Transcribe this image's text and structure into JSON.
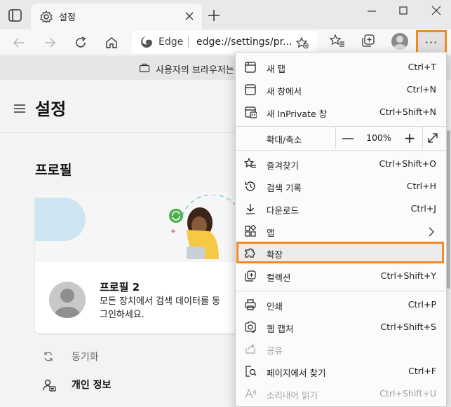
{
  "window": {
    "tab_title": "설정"
  },
  "toolbar": {
    "address_brand": "Edge",
    "address_url": "edge://settings/pr..."
  },
  "infobar": {
    "text": "사용자의 브라우저는"
  },
  "settings": {
    "title": "설정",
    "section_title": "프로필",
    "profile_name": "프로필 2",
    "profile_desc_line1": "모든 장치에서 검색 데이터를 동",
    "profile_desc_line2": "그인하세요.",
    "sync_label": "동기화",
    "personal_info_label": "개인 정보"
  },
  "menu": {
    "items_top": [
      {
        "label": "새 탭",
        "shortcut": "Ctrl+T",
        "icon": "new-tab-icon"
      },
      {
        "label": "새 창에서",
        "shortcut": "Ctrl+N",
        "icon": "new-window-icon"
      },
      {
        "label": "새 InPrivate 창",
        "shortcut": "Ctrl+Shift+N",
        "icon": "inprivate-icon"
      }
    ],
    "zoom": {
      "label": "확대/축소",
      "minus": "—",
      "value": "100%",
      "plus": "+"
    },
    "items_mid": [
      {
        "label": "즐겨찾기",
        "shortcut": "Ctrl+Shift+O",
        "icon": "favorites-icon"
      },
      {
        "label": "검색 기록",
        "shortcut": "Ctrl+H",
        "icon": "history-icon"
      },
      {
        "label": "다운로드",
        "shortcut": "Ctrl+J",
        "icon": "download-icon"
      },
      {
        "label": "앱",
        "shortcut": "",
        "icon": "apps-icon"
      },
      {
        "label": "확장",
        "shortcut": "",
        "icon": "extensions-icon"
      },
      {
        "label": "컬렉션",
        "shortcut": "Ctrl+Shift+Y",
        "icon": "collections-icon"
      }
    ],
    "items_bottom": [
      {
        "label": "인쇄",
        "shortcut": "Ctrl+P",
        "icon": "print-icon"
      },
      {
        "label": "웹 캡처",
        "shortcut": "Ctrl+Shift+S",
        "icon": "web-capture-icon"
      },
      {
        "label": "공유",
        "shortcut": "",
        "icon": "share-icon"
      },
      {
        "label": "페이지에서 찾기",
        "shortcut": "Ctrl+F",
        "icon": "find-icon"
      },
      {
        "label": "소리내어 읽기",
        "shortcut": "Ctrl+Shift+U",
        "icon": "read-aloud-icon"
      }
    ]
  },
  "colors": {
    "highlight": "#f28a24",
    "cloud": "#cfe6f2"
  }
}
